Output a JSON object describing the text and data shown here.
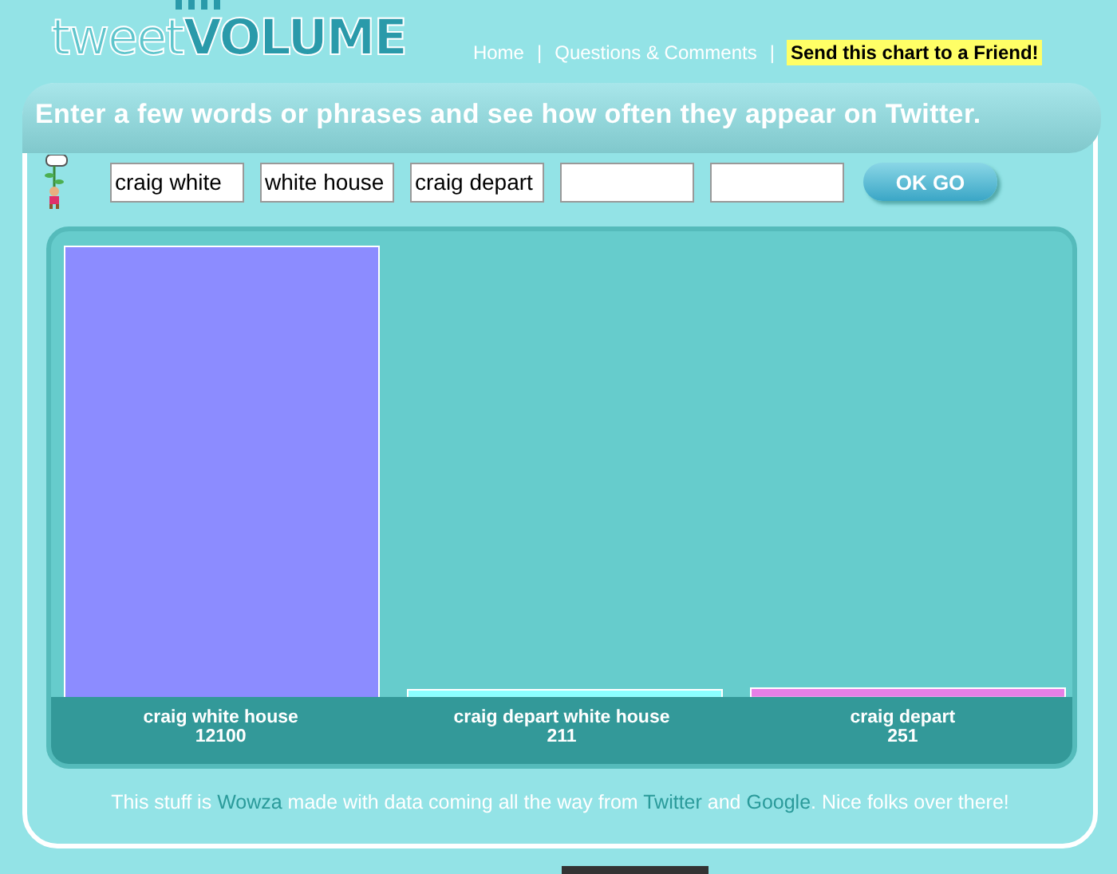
{
  "logo": {
    "light": "tweet",
    "bold": "VOLUME"
  },
  "nav": [
    {
      "label": "Home",
      "kind": "link"
    },
    {
      "label": "|",
      "kind": "sep"
    },
    {
      "label": "Questions & Comments",
      "kind": "link"
    },
    {
      "label": "|",
      "kind": "sep"
    },
    {
      "label": "Send this chart to a Friend!",
      "kind": "highlight"
    }
  ],
  "banner": "Enter a few words or phrases and see how often they appear on Twitter.",
  "fields": [
    {
      "kind": "filled",
      "value": "craig white"
    },
    {
      "kind": "filled",
      "value": "white house"
    },
    {
      "kind": "filled",
      "value": "craig depart"
    },
    {
      "kind": "blank"
    },
    {
      "kind": "blank"
    }
  ],
  "go_button": "OK GO",
  "chart": {
    "chart_data": {
      "type": "bar",
      "categories": [
        "craig white house",
        "craig depart white house",
        "craig depart"
      ],
      "series": [
        {
          "values": [
            12100,
            211,
            251
          ]
        }
      ],
      "colors": [
        "#8c8cff",
        "#8cffff",
        "#e67fe6"
      ],
      "data_labels": true,
      "value_labels": [
        "12100",
        "211",
        "251"
      ]
    }
  },
  "footer": [
    {
      "text": "This stuff is ",
      "kind": "text"
    },
    {
      "text": "Wowza",
      "kind": "link"
    },
    {
      "text": " made with data coming all the way from ",
      "kind": "text"
    },
    {
      "text": "Twitter",
      "kind": "link"
    },
    {
      "text": " and ",
      "kind": "text"
    },
    {
      "text": "Google",
      "kind": "link"
    },
    {
      "text": ". Nice folks over there!",
      "kind": "text"
    }
  ]
}
